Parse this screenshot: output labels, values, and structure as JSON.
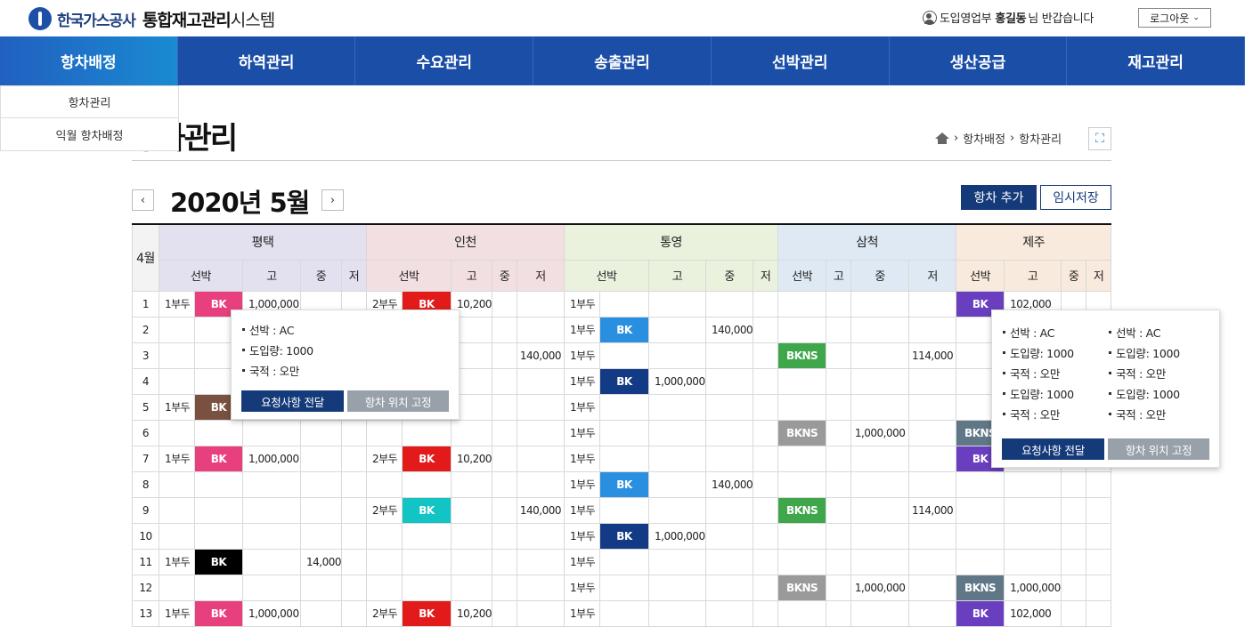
{
  "header": {
    "company": "한국가스공사",
    "sys_bold": "통합재고관리",
    "sys_rest": "시스템",
    "user_dept": "도입영업부",
    "user_name": "홍길동",
    "user_suffix": "님 반갑습니다",
    "logout": "로그아웃"
  },
  "nav": [
    "항차배정",
    "하역관리",
    "수요관리",
    "송출관리",
    "선박관리",
    "생산공급",
    "재고관리"
  ],
  "submenu": [
    "항차관리",
    "익월 항차배정"
  ],
  "page": {
    "title": "항차관리",
    "crumb1": "항차배정",
    "crumb2": "항차관리",
    "month": "2020년 5월",
    "prev": "‹",
    "next": "›",
    "add": "항차 추가",
    "temp": "임시저장"
  },
  "table": {
    "corner": "4월",
    "ports": [
      "평택",
      "인천",
      "통영",
      "삼척",
      "제주"
    ],
    "sub": [
      [
        "선박",
        "고",
        "중",
        "저"
      ],
      [
        "선박",
        "고",
        "중",
        "저"
      ],
      [
        "선박",
        "고",
        "중",
        "저"
      ],
      [
        "선박",
        "고",
        "중",
        "저"
      ],
      [
        "선박",
        "고",
        "중",
        "저"
      ]
    ],
    "colors": {
      "pink": "#e8407e",
      "red": "#e31a1a",
      "blue": "#2b8fe0",
      "navy": "#133a84",
      "green": "#3fa64b",
      "gray": "#9a9a9a",
      "slate": "#5f7786",
      "purple": "#6a3fbf",
      "brown": "#7a5140",
      "black": "#000000",
      "teal": "#12c4c4"
    },
    "rows": [
      {
        "n": "1",
        "p": [
          [
            "1부두",
            "BK",
            "pink",
            "1,000,000",
            "",
            ""
          ],
          [
            "2부두",
            "BK",
            "red",
            "10,200",
            "",
            ""
          ],
          [
            "1부두",
            "",
            "",
            "",
            "",
            ""
          ],
          [
            "",
            "",
            "",
            "",
            "",
            ""
          ],
          [
            "",
            "BK",
            "purple",
            "102,000",
            "",
            ""
          ]
        ]
      },
      {
        "n": "2",
        "p": [
          [
            "",
            "",
            "",
            "",
            "",
            ""
          ],
          [
            "",
            "",
            "",
            "",
            "",
            ""
          ],
          [
            "1부두",
            "BK",
            "blue",
            "",
            "140,000",
            ""
          ],
          [
            "",
            "",
            "",
            "",
            "",
            ""
          ],
          [
            "",
            "",
            "",
            "",
            "",
            ""
          ]
        ]
      },
      {
        "n": "3",
        "p": [
          [
            "",
            "",
            "",
            "",
            "",
            ""
          ],
          [
            "",
            "",
            "",
            "",
            "",
            "140,000"
          ],
          [
            "1부두",
            "",
            "",
            "",
            "",
            ""
          ],
          [
            "",
            "BKNS",
            "green",
            "",
            "",
            "114,000"
          ],
          [
            "",
            "",
            "",
            "",
            "",
            ""
          ]
        ]
      },
      {
        "n": "4",
        "p": [
          [
            "",
            "",
            "",
            "",
            "",
            ""
          ],
          [
            "",
            "",
            "",
            "",
            "",
            ""
          ],
          [
            "1부두",
            "BK",
            "navy",
            "1,000,000",
            "",
            ""
          ],
          [
            "",
            "",
            "",
            "",
            "",
            ""
          ],
          [
            "",
            "",
            "",
            "",
            "",
            ""
          ]
        ]
      },
      {
        "n": "5",
        "p": [
          [
            "1부두",
            "BK",
            "brown",
            "",
            "",
            ""
          ],
          [
            "",
            "",
            "",
            "",
            "",
            ""
          ],
          [
            "1부두",
            "",
            "",
            "",
            "",
            ""
          ],
          [
            "",
            "",
            "",
            "",
            "",
            ""
          ],
          [
            "",
            "",
            "",
            "",
            "",
            ""
          ]
        ]
      },
      {
        "n": "6",
        "p": [
          [
            "",
            "",
            "",
            "",
            "",
            ""
          ],
          [
            "",
            "",
            "",
            "",
            "",
            ""
          ],
          [
            "1부두",
            "",
            "",
            "",
            "",
            ""
          ],
          [
            "",
            "BKNS",
            "gray",
            "",
            "1,000,000",
            ""
          ],
          [
            "",
            "BKNS",
            "slate",
            "",
            "",
            ""
          ]
        ]
      },
      {
        "n": "7",
        "p": [
          [
            "1부두",
            "BK",
            "pink",
            "1,000,000",
            "",
            ""
          ],
          [
            "2부두",
            "BK",
            "red",
            "10,200",
            "",
            ""
          ],
          [
            "1부두",
            "",
            "",
            "",
            "",
            ""
          ],
          [
            "",
            "",
            "",
            "",
            "",
            ""
          ],
          [
            "",
            "BK",
            "purple",
            "",
            "",
            ""
          ]
        ]
      },
      {
        "n": "8",
        "p": [
          [
            "",
            "",
            "",
            "",
            "",
            ""
          ],
          [
            "",
            "",
            "",
            "",
            "",
            ""
          ],
          [
            "1부두",
            "BK",
            "blue",
            "",
            "140,000",
            ""
          ],
          [
            "",
            "",
            "",
            "",
            "",
            ""
          ],
          [
            "",
            "",
            "",
            "",
            "",
            ""
          ]
        ]
      },
      {
        "n": "9",
        "p": [
          [
            "",
            "",
            "",
            "",
            "",
            ""
          ],
          [
            "2부두",
            "BK",
            "teal",
            "",
            "",
            "140,000"
          ],
          [
            "1부두",
            "",
            "",
            "",
            "",
            ""
          ],
          [
            "",
            "BKNS",
            "green",
            "",
            "",
            "114,000"
          ],
          [
            "",
            "",
            "",
            "",
            "",
            ""
          ]
        ]
      },
      {
        "n": "10",
        "p": [
          [
            "",
            "",
            "",
            "",
            "",
            ""
          ],
          [
            "",
            "",
            "",
            "",
            "",
            ""
          ],
          [
            "1부두",
            "BK",
            "navy",
            "1,000,000",
            "",
            ""
          ],
          [
            "",
            "",
            "",
            "",
            "",
            ""
          ],
          [
            "",
            "",
            "",
            "",
            "",
            ""
          ]
        ]
      },
      {
        "n": "11",
        "p": [
          [
            "1부두",
            "BK",
            "black",
            "",
            "14,000",
            ""
          ],
          [
            "",
            "",
            "",
            "",
            "",
            ""
          ],
          [
            "1부두",
            "",
            "",
            "",
            "",
            ""
          ],
          [
            "",
            "",
            "",
            "",
            "",
            ""
          ],
          [
            "",
            "",
            "",
            "",
            "",
            ""
          ]
        ]
      },
      {
        "n": "12",
        "p": [
          [
            "",
            "",
            "",
            "",
            "",
            ""
          ],
          [
            "",
            "",
            "",
            "",
            "",
            ""
          ],
          [
            "1부두",
            "",
            "",
            "",
            "",
            ""
          ],
          [
            "",
            "BKNS",
            "gray",
            "",
            "1,000,000",
            ""
          ],
          [
            "",
            "BKNS",
            "slate",
            "1,000,000",
            "",
            ""
          ]
        ]
      },
      {
        "n": "13",
        "p": [
          [
            "1부두",
            "BK",
            "pink",
            "1,000,000",
            "",
            ""
          ],
          [
            "2부두",
            "BK",
            "red",
            "10,200",
            "",
            ""
          ],
          [
            "1부두",
            "",
            "",
            "",
            "",
            ""
          ],
          [
            "",
            "",
            "",
            "",
            "",
            ""
          ],
          [
            "",
            "BK",
            "purple",
            "102,000",
            "",
            ""
          ]
        ]
      }
    ]
  },
  "popup1": {
    "items": [
      "선박 : AC",
      "도입량: 1000",
      "국적 : 오만"
    ],
    "btn1": "요청사항 전달",
    "btn2": "항차 위치 고정"
  },
  "popup2": {
    "left": [
      "선박 : AC",
      "도입량: 1000",
      "국적 : 오만",
      "도입량: 1000",
      "국적 : 오만"
    ],
    "right": [
      "선박 : AC",
      "도입량: 1000",
      "국적 : 오만",
      "도입량: 1000",
      "국적 : 오만"
    ],
    "btn1": "요청사항 전달",
    "btn2": "항차 위치 고정"
  }
}
